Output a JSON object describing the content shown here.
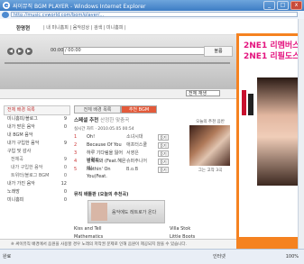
{
  "window": {
    "title": "싸이뮤직 BGM PLAYER - Windows Internet Explorer",
    "min": "_",
    "max": "□",
    "close": "x"
  },
  "address": {
    "url": "http://music.cyworld.com/bgm/player/..."
  },
  "topnav": {
    "user": "한명현",
    "links": "| 내 미니홈피 | 음악감상 | 검색 | 미니홈피 |"
  },
  "player": {
    "time": "00:00 / 00:00",
    "volume": "볼륨",
    "progress": 0
  },
  "main": {
    "select": "전체 재생"
  },
  "left": {
    "header": "전체 배경 목록",
    "items": [
      {
        "label": "미니홈피/블로그",
        "count": "9"
      },
      {
        "label": "내가 받은 음악",
        "count": "0"
      },
      {
        "label": "내 BGM 음악",
        "count": ""
      },
      {
        "label": "내가 구입한 음악",
        "count": "9"
      },
      {
        "label": "구입 및 감사",
        "count": ""
      },
      {
        "label": "전체곡",
        "count": "9"
      },
      {
        "label": "내가 구입한 음악",
        "count": "0"
      },
      {
        "label": "트위터/블로그 BGM",
        "count": "0"
      },
      {
        "label": "내가 가진 음악",
        "count": "12"
      },
      {
        "label": "노래방",
        "count": "0"
      },
      {
        "label": "미니홈피",
        "count": "0"
      }
    ]
  },
  "tabs": [
    {
      "label": "전체 배경 목록"
    },
    {
      "label": "추천 BGM"
    }
  ],
  "panel": {
    "section1": "스페셜 추천",
    "section1_sub": "산정한 맞춤곡",
    "date": "실시간 차트 · 2010.05.05 00:54",
    "tracks": [
      {
        "n": "1",
        "title": "Oh!",
        "artist": "소녀시대",
        "btn": "듣기"
      },
      {
        "n": "2",
        "title": "Because Of You",
        "artist": "애프터스쿨",
        "btn": "듣기"
      },
      {
        "n": "3",
        "title": "하루 기다림을 잃어버렸으",
        "artist": "서영은",
        "btn": "듣기"
      },
      {
        "n": "4",
        "title": "잘해줘봐 (Feat.혜은이)",
        "artist": "슈퍼주니어",
        "btn": "듣기"
      },
      {
        "n": "5",
        "title": "Nothin' On You(Feat.",
        "artist": "B.o.B",
        "btn": "듣기"
      }
    ],
    "album_caption": "오늘의 추천 음반",
    "album_title": "그는 고작 3곡",
    "section2": "뮤직 배틀판 (오늘의 추천곡)",
    "banner_text": "음악에도 레트로가 온다",
    "playlist": [
      {
        "left": "Kiss and Tell",
        "right": "Villa Stok"
      },
      {
        "left": "Mathematics",
        "right": "Little Boots"
      },
      {
        "left": "This Must Be It",
        "right": "Röyksopp"
      }
    ]
  },
  "footer": {
    "text": "※ 싸이뮤직 배경에서 음원을 사용할 경우 노래의 저작권 문제로 인해 음원이 제공되지 않을 수 있습니다."
  },
  "ad": {
    "line1": "2NE1 리멤버스",
    "line2": "2NE1 리필도스"
  },
  "status": {
    "done": "완료",
    "zone": "인터넷",
    "zoom": "100%"
  }
}
